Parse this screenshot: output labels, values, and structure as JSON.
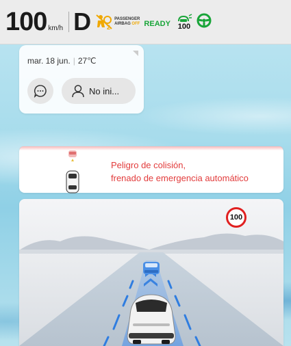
{
  "status_bar": {
    "speed": "100",
    "speed_unit": "km/h",
    "gear": "D",
    "airbag_line1": "PASSENGER",
    "airbag_line2_a": "AIRBAG",
    "airbag_line2_b": "OFF",
    "ready": "READY",
    "acc_speed": "100"
  },
  "info_card": {
    "date": "mar. 18 jun.",
    "temperature": "27℃",
    "profile_label": "No ini..."
  },
  "alert": {
    "line1": "Peligro de colisión,",
    "line2": "frenado de emergencia automático"
  },
  "road_view": {
    "speed_limit": "100"
  },
  "colors": {
    "ready_green": "#19a539",
    "alert_red": "#e23b3b",
    "lane_blue": "#2f7de0"
  }
}
